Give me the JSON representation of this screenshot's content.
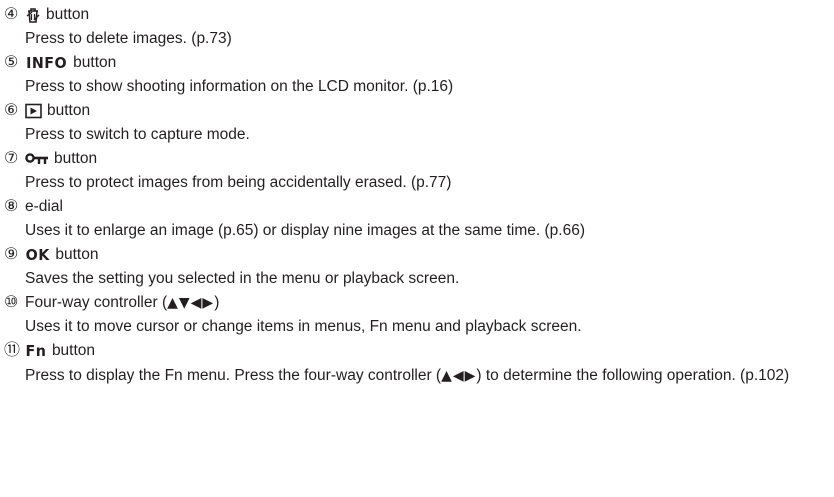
{
  "entries": [
    {
      "num": "④",
      "icon": "trash-icon",
      "head_text": "button",
      "desc": "Press to delete images. (p.73)"
    },
    {
      "num": "⑤",
      "symbol": "INFO",
      "head_text": "button",
      "desc": "Press to show shooting information on the LCD monitor. (p.16)"
    },
    {
      "num": "⑥",
      "icon": "playback-icon",
      "head_text": "button",
      "desc": "Press to switch to capture mode."
    },
    {
      "num": "⑦",
      "icon": "key-icon",
      "head_text": "button",
      "desc": "Press to protect images from being accidentally erased. (p.77)"
    },
    {
      "num": "⑧",
      "head_text": "e-dial",
      "desc": "Uses it to enlarge an image (p.65) or display nine images at the same time. (p.66)"
    },
    {
      "num": "⑨",
      "symbol": "OK",
      "head_text": "button",
      "desc": "Saves the setting you selected in the menu or playback screen."
    },
    {
      "num": "⑩",
      "head_text": "Four-way controller (",
      "arrows": "▲▼◀▶",
      "head_close": ")",
      "desc": "Uses it to move cursor or change items in menus, Fn menu and playback screen."
    },
    {
      "num": "⑪",
      "symbol": "Fn",
      "head_text": "button",
      "desc_part1": "Press to display the Fn menu. Press the four-way controller (",
      "desc_arrows": "▲◀▶",
      "desc_part2": ") to determine the following operation. (p.102)"
    }
  ]
}
